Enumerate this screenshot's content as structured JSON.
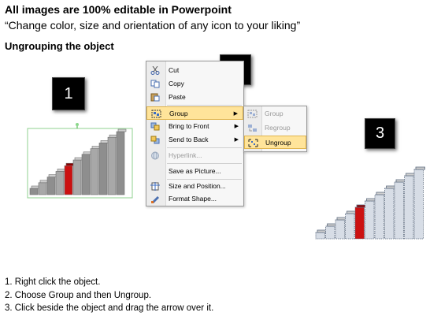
{
  "header": {
    "title": "All images are 100% editable in Powerpoint",
    "subtitle": "“Change color, size and orientation of any icon to your liking”",
    "section": "Ungrouping the object"
  },
  "badges": {
    "one": "1",
    "two": "2",
    "three": "3"
  },
  "context_menu": {
    "items": [
      {
        "label": "Cut",
        "icon": "scissors-icon"
      },
      {
        "label": "Copy",
        "icon": "copy-icon"
      },
      {
        "label": "Paste",
        "icon": "paste-icon"
      },
      {
        "label": "Group",
        "icon": "group-icon",
        "highlighted": true,
        "submenu": true
      },
      {
        "label": "Bring to Front",
        "icon": "bring-to-front-icon",
        "submenu": true
      },
      {
        "label": "Send to Back",
        "icon": "send-to-back-icon",
        "submenu": true
      },
      {
        "label": "Hyperlink...",
        "icon": "hyperlink-icon",
        "disabled": true
      },
      {
        "label": "Save as Picture..."
      },
      {
        "label": "Size and Position...",
        "icon": "size-position-icon"
      },
      {
        "label": "Format Shape...",
        "icon": "format-shape-icon"
      }
    ]
  },
  "submenu": {
    "items": [
      {
        "label": "Group",
        "icon": "group-icon",
        "disabled": true
      },
      {
        "label": "Regroup",
        "icon": "regroup-icon",
        "disabled": true
      },
      {
        "label": "Ungroup",
        "icon": "ungroup-icon",
        "highlighted": true
      }
    ]
  },
  "steps": [
    "1.  Right click the object.",
    "2.  Choose Group and then Ungroup.",
    "3.  Click beside the object and drag the arrow over it."
  ],
  "colors": {
    "highlight": "#ffe49a",
    "accent_bar": "#cc1111",
    "bar_gray": "#9a9a9a"
  }
}
